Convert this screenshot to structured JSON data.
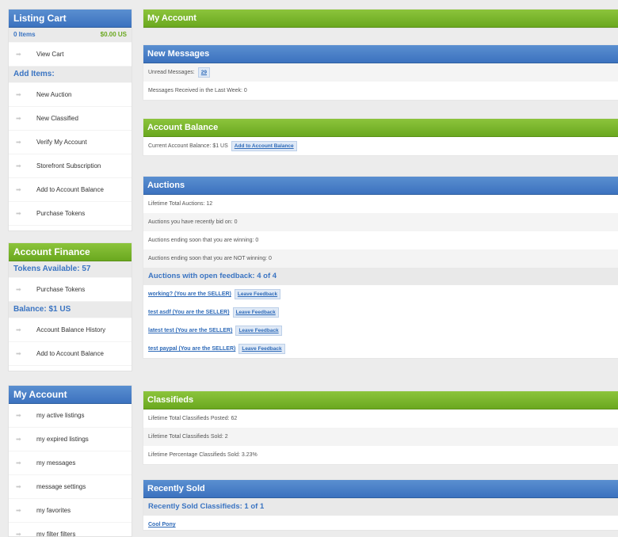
{
  "listing_cart": {
    "title": "Listing Cart",
    "item_count": "0 Items",
    "total": "$0.00 US",
    "view_cart": "View Cart",
    "add_items_label": "Add Items:",
    "add_items": [
      "New Auction",
      "New Classified",
      "Verify My Account",
      "Storefront Subscription",
      "Add to Account Balance",
      "Purchase Tokens"
    ]
  },
  "account_finance": {
    "title": "Account Finance",
    "tokens_label": "Tokens Available: 57",
    "purchase_tokens": "Purchase Tokens",
    "balance_label": "Balance: $1 US",
    "balance_history": "Account Balance History",
    "add_balance": "Add to Account Balance"
  },
  "my_account_nav": {
    "title": "My Account",
    "items": [
      "my active listings",
      "my expired listings",
      "my messages",
      "message settings",
      "my favorites",
      "my filter filters"
    ]
  },
  "main": {
    "title": "My Account",
    "messages": {
      "title": "New Messages",
      "unread_label": "Unread Messages:",
      "unread_count": "29",
      "received": "Messages Received in the Last Week: 0"
    },
    "balance": {
      "title": "Account Balance",
      "current": "Current Account Balance: $1 US",
      "add_button": "Add to Account Balance"
    },
    "auctions": {
      "title": "Auctions",
      "lines": [
        "Lifetime Total Auctions: 12",
        "Auctions you have recently bid on: 0",
        "Auctions ending soon that you are winning: 0",
        "Auctions ending soon that you are NOT winning: 0"
      ],
      "feedback_header": "Auctions with open feedback: 4 of 4",
      "feedback_button": "Leave Feedback",
      "feedback_items": [
        "working? (You are the SELLER)",
        "test asdf (You are the SELLER)",
        "latest test (You are the SELLER)",
        "test paypal (You are the SELLER)"
      ]
    },
    "classifieds": {
      "title": "Classifieds",
      "lines": [
        "Lifetime Total Classifieds Posted: 62",
        "Lifetime Total Classifieds Sold: 2",
        "Lifetime Percentage Classifieds Sold: 3.23%"
      ]
    },
    "recently_sold": {
      "title": "Recently Sold",
      "subheader": "Recently Sold Classifieds: 1 of 1",
      "item": "Cool Pony"
    }
  },
  "icons": {
    "nav_bullet": "arrow-right-icon"
  },
  "colors": {
    "blue": "#3c72bf",
    "green": "#6aa81f",
    "link": "#2e6ab8"
  }
}
